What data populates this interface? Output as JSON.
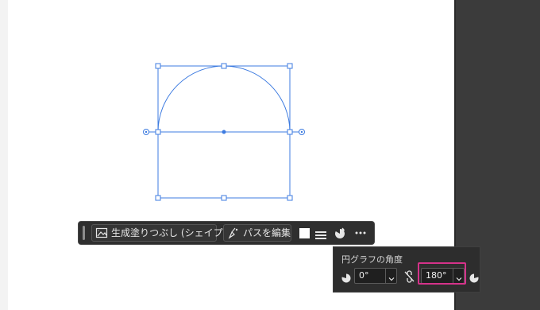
{
  "toolbar": {
    "generative_fill_label": "生成塗りつぶし (シェイプ)",
    "edit_path_label": "パスを編集",
    "fill_color": "#ffffff",
    "more_icon": "more-icon"
  },
  "pie_panel": {
    "title": "円グラフの角度",
    "start_angle": "0°",
    "end_angle": "180°"
  },
  "colors": {
    "selection": "#3d7be0",
    "highlight": "#d5328a",
    "canvas_bg": "#3b3b3b",
    "artboard": "#ffffff"
  }
}
